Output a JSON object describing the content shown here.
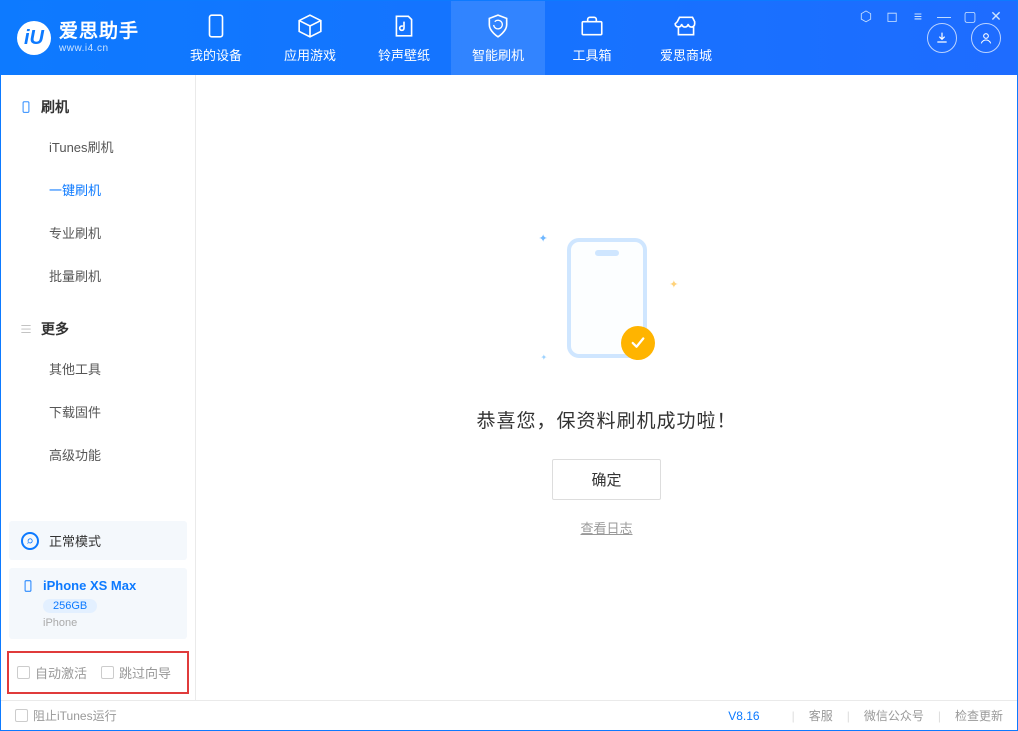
{
  "app": {
    "title": "爱思助手",
    "subtitle": "www.i4.cn"
  },
  "nav": {
    "items": [
      {
        "label": "我的设备"
      },
      {
        "label": "应用游戏"
      },
      {
        "label": "铃声壁纸"
      },
      {
        "label": "智能刷机"
      },
      {
        "label": "工具箱"
      },
      {
        "label": "爱思商城"
      }
    ]
  },
  "sidebar": {
    "flash": {
      "header": "刷机",
      "items": [
        "iTunes刷机",
        "一键刷机",
        "专业刷机",
        "批量刷机"
      ],
      "active": "一键刷机"
    },
    "more": {
      "header": "更多",
      "items": [
        "其他工具",
        "下载固件",
        "高级功能"
      ]
    },
    "mode": "正常模式",
    "device": {
      "name": "iPhone XS Max",
      "storage": "256GB",
      "type": "iPhone"
    },
    "options": {
      "auto_activate": "自动激活",
      "skip_guide": "跳过向导"
    }
  },
  "main": {
    "message": "恭喜您，保资料刷机成功啦！",
    "ok": "确定",
    "view_log": "查看日志"
  },
  "footer": {
    "prevent_itunes": "阻止iTunes运行",
    "version": "V8.16",
    "support": "客服",
    "wechat": "微信公众号",
    "check_update": "检查更新"
  }
}
